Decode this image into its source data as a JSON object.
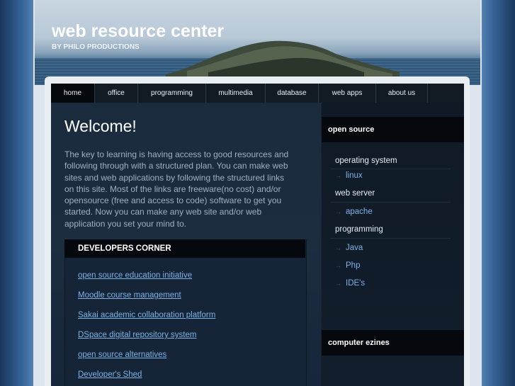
{
  "site": {
    "title": "web resource center",
    "subtitle": "BY PHILO PRODUCTIONS"
  },
  "nav": {
    "items": [
      {
        "label": "home"
      },
      {
        "label": "office"
      },
      {
        "label": "programming"
      },
      {
        "label": "multimedia"
      },
      {
        "label": "database"
      },
      {
        "label": "web apps"
      },
      {
        "label": "about us"
      }
    ]
  },
  "main": {
    "heading": "Welcome!",
    "intro": "The key to learning is having access to good resources and following through with a structured plan. You can make web sites and web applications by following the structured links on this site. Most of the links are freeware(no cost) and/or opensource (free and access to code) software to get you started. Now you can make any web site and/or web application you set your mind to."
  },
  "developers": {
    "heading": "DEVELOPERS CORNER",
    "links": [
      "open source education initiative",
      "Moodle course management",
      "Sakai academic collaboration platform",
      "DSpace digital repository system",
      "open source alternatives",
      "Developer's Shed"
    ]
  },
  "sidebar": {
    "open_source_heading": "open source",
    "categories": [
      {
        "label": "operating system",
        "links": [
          "linux"
        ]
      },
      {
        "label": "web server",
        "links": [
          "apache"
        ]
      },
      {
        "label": "programming",
        "links": [
          "Java",
          "Php",
          "IDE's"
        ]
      }
    ],
    "ezines_heading": "computer ezines",
    "arrow": "→"
  },
  "colors": {
    "link": "#7fb2e6",
    "nav_bg": "#121b24",
    "content_bg": "#1a2b3d",
    "heading_bg": "#05090d"
  }
}
